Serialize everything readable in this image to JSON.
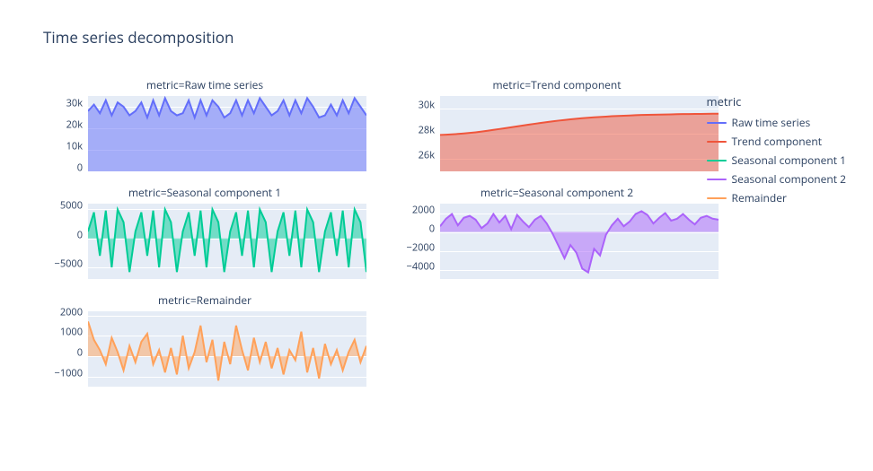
{
  "title": "Time series decomposition",
  "legend": {
    "title": "metric",
    "items": [
      {
        "label": "Raw time series",
        "stroke": "#636efa",
        "fill": "rgba(99,110,250,0.5)"
      },
      {
        "label": "Trend component",
        "stroke": "#ef553b",
        "fill": "rgba(239,85,59,0.5)"
      },
      {
        "label": "Seasonal component 1",
        "stroke": "#00cc96",
        "fill": "rgba(0,204,150,0.5)"
      },
      {
        "label": "Seasonal component 2",
        "stroke": "#ab63fa",
        "fill": "rgba(171,99,250,0.5)"
      },
      {
        "label": "Remainder",
        "stroke": "#ffa15a",
        "fill": "rgba(255,161,90,0.5)"
      }
    ]
  },
  "chart_data": [
    {
      "id": "raw",
      "name": "Raw time series",
      "title_prefix": "metric=",
      "type": "area",
      "ylim": [
        0,
        35000
      ],
      "yticks": [
        0,
        "10k",
        "20k",
        "30k"
      ],
      "ytick_vals": [
        0,
        10000,
        20000,
        30000
      ],
      "values": [
        28000,
        31000,
        27000,
        33000,
        26000,
        32000,
        30000,
        26000,
        28000,
        32000,
        25000,
        33000,
        26000,
        34000,
        28000,
        26000,
        27000,
        33000,
        25000,
        33000,
        26000,
        33000,
        30000,
        25000,
        27000,
        33000,
        26000,
        33000,
        27000,
        34000,
        30000,
        26000,
        28000,
        33000,
        26000,
        33000,
        27000,
        34000,
        30000,
        25000,
        26000,
        31000,
        26000,
        33000,
        27000,
        34000,
        30000,
        26000
      ],
      "color_idx": 0
    },
    {
      "id": "trend",
      "name": "Trend component",
      "title_prefix": "metric=",
      "type": "area",
      "ylim": [
        25000,
        31000
      ],
      "yticks": [
        "26k",
        "28k",
        "30k"
      ],
      "ytick_vals": [
        26000,
        28000,
        30000
      ],
      "values": [
        27900,
        27920,
        27950,
        27980,
        28020,
        28060,
        28110,
        28170,
        28230,
        28300,
        28370,
        28440,
        28510,
        28580,
        28650,
        28720,
        28790,
        28860,
        28920,
        28980,
        29040,
        29090,
        29140,
        29190,
        29230,
        29270,
        29300,
        29330,
        29360,
        29390,
        29410,
        29430,
        29450,
        29470,
        29490,
        29500,
        29510,
        29520,
        29530,
        29540,
        29550,
        29560,
        29565,
        29570,
        29575,
        29580,
        29585,
        29590
      ],
      "color_idx": 1
    },
    {
      "id": "seasonal1",
      "name": "Seasonal component 1",
      "title_prefix": "metric=",
      "type": "area",
      "ylim": [
        -7000,
        6000
      ],
      "yticks": [
        "−5000",
        "0",
        "5000"
      ],
      "ytick_vals": [
        -5000,
        0,
        5000
      ],
      "values": [
        1200,
        4500,
        -3000,
        4800,
        -5000,
        5000,
        2800,
        -5800,
        1200,
        4500,
        -3000,
        4800,
        -5000,
        5000,
        2800,
        -5800,
        1200,
        4500,
        -3000,
        4800,
        -5000,
        5000,
        2800,
        -5800,
        1200,
        4500,
        -3000,
        4800,
        -5000,
        5000,
        2800,
        -5800,
        1200,
        4500,
        -3000,
        4800,
        -5000,
        5000,
        2800,
        -5800,
        1200,
        4500,
        -3000,
        4800,
        -5000,
        5000,
        2800,
        -5800
      ],
      "color_idx": 2
    },
    {
      "id": "seasonal2",
      "name": "Seasonal component 2",
      "title_prefix": "metric=",
      "type": "area",
      "ylim": [
        -5000,
        3000
      ],
      "yticks": [
        "−4000",
        "−2000",
        "0",
        "2000"
      ],
      "ytick_vals": [
        -4000,
        -2000,
        0,
        2000
      ],
      "values": [
        600,
        1400,
        1900,
        700,
        1500,
        1700,
        1300,
        400,
        900,
        1900,
        1000,
        1700,
        300,
        1800,
        1100,
        500,
        1300,
        1700,
        900,
        -200,
        -1500,
        -2800,
        -1400,
        -2200,
        -3900,
        -4300,
        -1800,
        -2500,
        -300,
        700,
        1400,
        600,
        1100,
        1900,
        2200,
        1800,
        900,
        1500,
        2000,
        1200,
        1400,
        1900,
        1300,
        800,
        1500,
        1700,
        1400,
        1300
      ],
      "color_idx": 3
    },
    {
      "id": "remainder",
      "name": "Remainder",
      "title_prefix": "metric=",
      "type": "area",
      "ylim": [
        -1500,
        2200
      ],
      "yticks": [
        "−1000",
        "0",
        "1000",
        "2000"
      ],
      "ytick_vals": [
        -1000,
        0,
        1000,
        2000
      ],
      "values": [
        1700,
        800,
        300,
        -400,
        900,
        200,
        -700,
        500,
        -300,
        700,
        1100,
        -400,
        300,
        -800,
        400,
        -900,
        1000,
        -600,
        200,
        1500,
        -300,
        800,
        -1200,
        700,
        -400,
        1500,
        300,
        -700,
        900,
        -300,
        700,
        -600,
        400,
        -900,
        300,
        -200,
        1200,
        -800,
        400,
        -1100,
        600,
        -400,
        300,
        -700,
        200,
        800,
        -300,
        500
      ],
      "color_idx": 4
    }
  ]
}
